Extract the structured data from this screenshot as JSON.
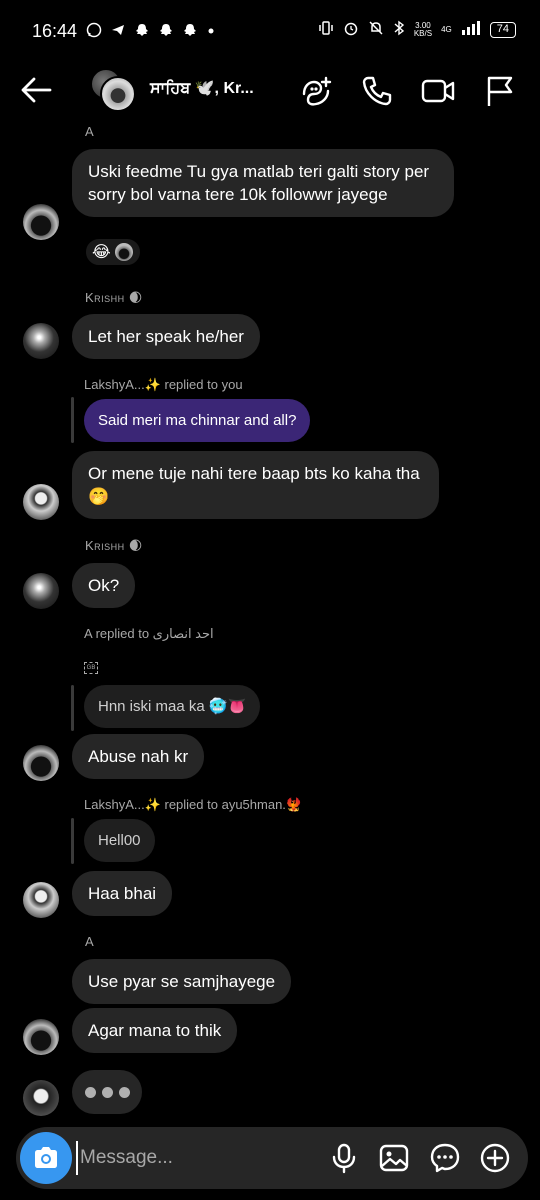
{
  "status_bar": {
    "time": "16:44",
    "left_icons": [
      "whatsapp-icon",
      "telegram-icon",
      "snapchat-icon",
      "snapchat-icon",
      "snapchat-icon",
      "dot-icon"
    ],
    "network_speed": "3.00",
    "network_unit": "KB/S",
    "network_type": "4G",
    "battery": "74"
  },
  "header": {
    "title": "ਸਾਹਿਬ 🕊️, Kr...",
    "icons": [
      "back-arrow-icon",
      "add-people-icon",
      "phone-icon",
      "video-icon",
      "flag-icon"
    ]
  },
  "messages": [
    {
      "sender": "A",
      "text": "Uski feedme Tu gya matlab teri galti story per sorry bol varna tere 10k followwr jayege",
      "reactions": "😂"
    },
    {
      "sender": "Krishh 🌒",
      "text": "Let her speak he/her"
    },
    {
      "reply_label": "LakshyA...✨ replied to you",
      "quoted": "Said meri ma chinnar and all?",
      "text": "Or mene tuje nahi tere baap bts ko kaha tha 🤭"
    },
    {
      "sender": "Krishh 🌒",
      "text": "Ok?"
    },
    {
      "reply_label": "A replied to احد انصاری",
      "quoted": "Hnn iski maa ka 🥶👅",
      "text": "Abuse nah kr"
    },
    {
      "reply_label": "LakshyA...✨ replied to ayu5hman.🐦‍🔥",
      "quoted": "Hell00",
      "text": "Haa bhai"
    },
    {
      "sender": "A",
      "text": "Use pyar se samjhayege"
    },
    {
      "text": "Agar mana to thik"
    }
  ],
  "composer": {
    "placeholder": "Message...",
    "icons": [
      "camera-icon",
      "microphone-icon",
      "image-icon",
      "sticker-chat-icon",
      "plus-icon"
    ]
  },
  "colors": {
    "background": "#000000",
    "bubble": "#262626",
    "own_bubble": "#3b2676",
    "accent": "#3797f0"
  }
}
